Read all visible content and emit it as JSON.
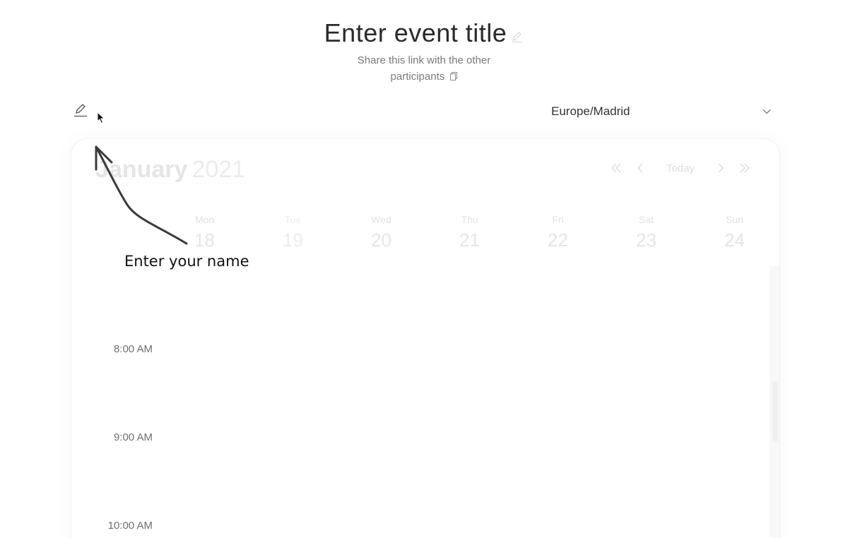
{
  "header": {
    "event_title": "Enter event title",
    "share_text": "Share this link with the other participants",
    "icons": {
      "title_edit": "pencil-icon",
      "copy": "copy-icon"
    }
  },
  "toolbar": {
    "name_edit_icon": "pencil-icon",
    "timezone": {
      "selected": "Europe/Madrid",
      "icon": "chevron-down-icon"
    }
  },
  "calendar": {
    "month": "January",
    "year": "2021",
    "nav": {
      "today_label": "Today",
      "icons": [
        "double-chevron-left-icon",
        "chevron-left-icon",
        "chevron-right-icon",
        "double-chevron-right-icon"
      ]
    },
    "days": [
      {
        "name": "Mon",
        "num": "18"
      },
      {
        "name": "Tue",
        "num": "19",
        "today": true
      },
      {
        "name": "Wed",
        "num": "20"
      },
      {
        "name": "Thu",
        "num": "21"
      },
      {
        "name": "Fri",
        "num": "22"
      },
      {
        "name": "Sat",
        "num": "23"
      },
      {
        "name": "Sun",
        "num": "24"
      }
    ],
    "times": [
      "8:00 AM",
      "9:00 AM",
      "10:00 AM"
    ]
  },
  "annotation": {
    "text": "Enter your name"
  }
}
